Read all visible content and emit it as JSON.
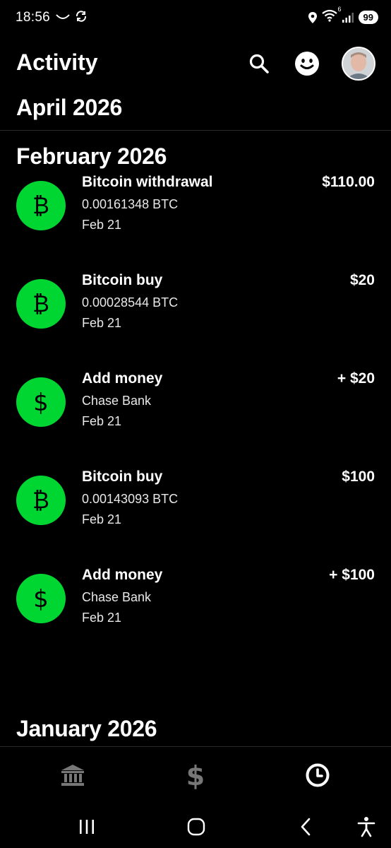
{
  "status": {
    "time": "18:56",
    "battery": "99",
    "wifi_sup": "6"
  },
  "header": {
    "title": "Activity",
    "search_icon": "search-icon",
    "smile_icon": "smile-icon",
    "avatar": "profile-avatar"
  },
  "sticky_month": "April 2026",
  "sections": {
    "february": {
      "heading": "February 2026",
      "transactions": [
        {
          "icon": "bitcoin-icon",
          "title": "Bitcoin withdrawal",
          "sub": "0.00161348 BTC",
          "date": "Feb 21",
          "amount": "$110.00"
        },
        {
          "icon": "bitcoin-icon",
          "title": "Bitcoin buy",
          "sub": "0.00028544 BTC",
          "date": "Feb 21",
          "amount": "$20"
        },
        {
          "icon": "dollar-icon",
          "title": "Add money",
          "sub": "Chase Bank",
          "date": "Feb 21",
          "amount": "+ $20"
        },
        {
          "icon": "bitcoin-icon",
          "title": "Bitcoin buy",
          "sub": "0.00143093 BTC",
          "date": "Feb 21",
          "amount": "$100"
        },
        {
          "icon": "dollar-icon",
          "title": "Add money",
          "sub": "Chase Bank",
          "date": "Feb 21",
          "amount": "+ $100"
        }
      ]
    },
    "january": {
      "heading": "January 2026"
    }
  },
  "tabs": [
    "bank-icon",
    "dollar-icon",
    "activity-clock-icon"
  ],
  "colors": {
    "accent": "#00d632",
    "background": "#000000",
    "text": "#ffffff",
    "tab_inactive": "#777777"
  }
}
